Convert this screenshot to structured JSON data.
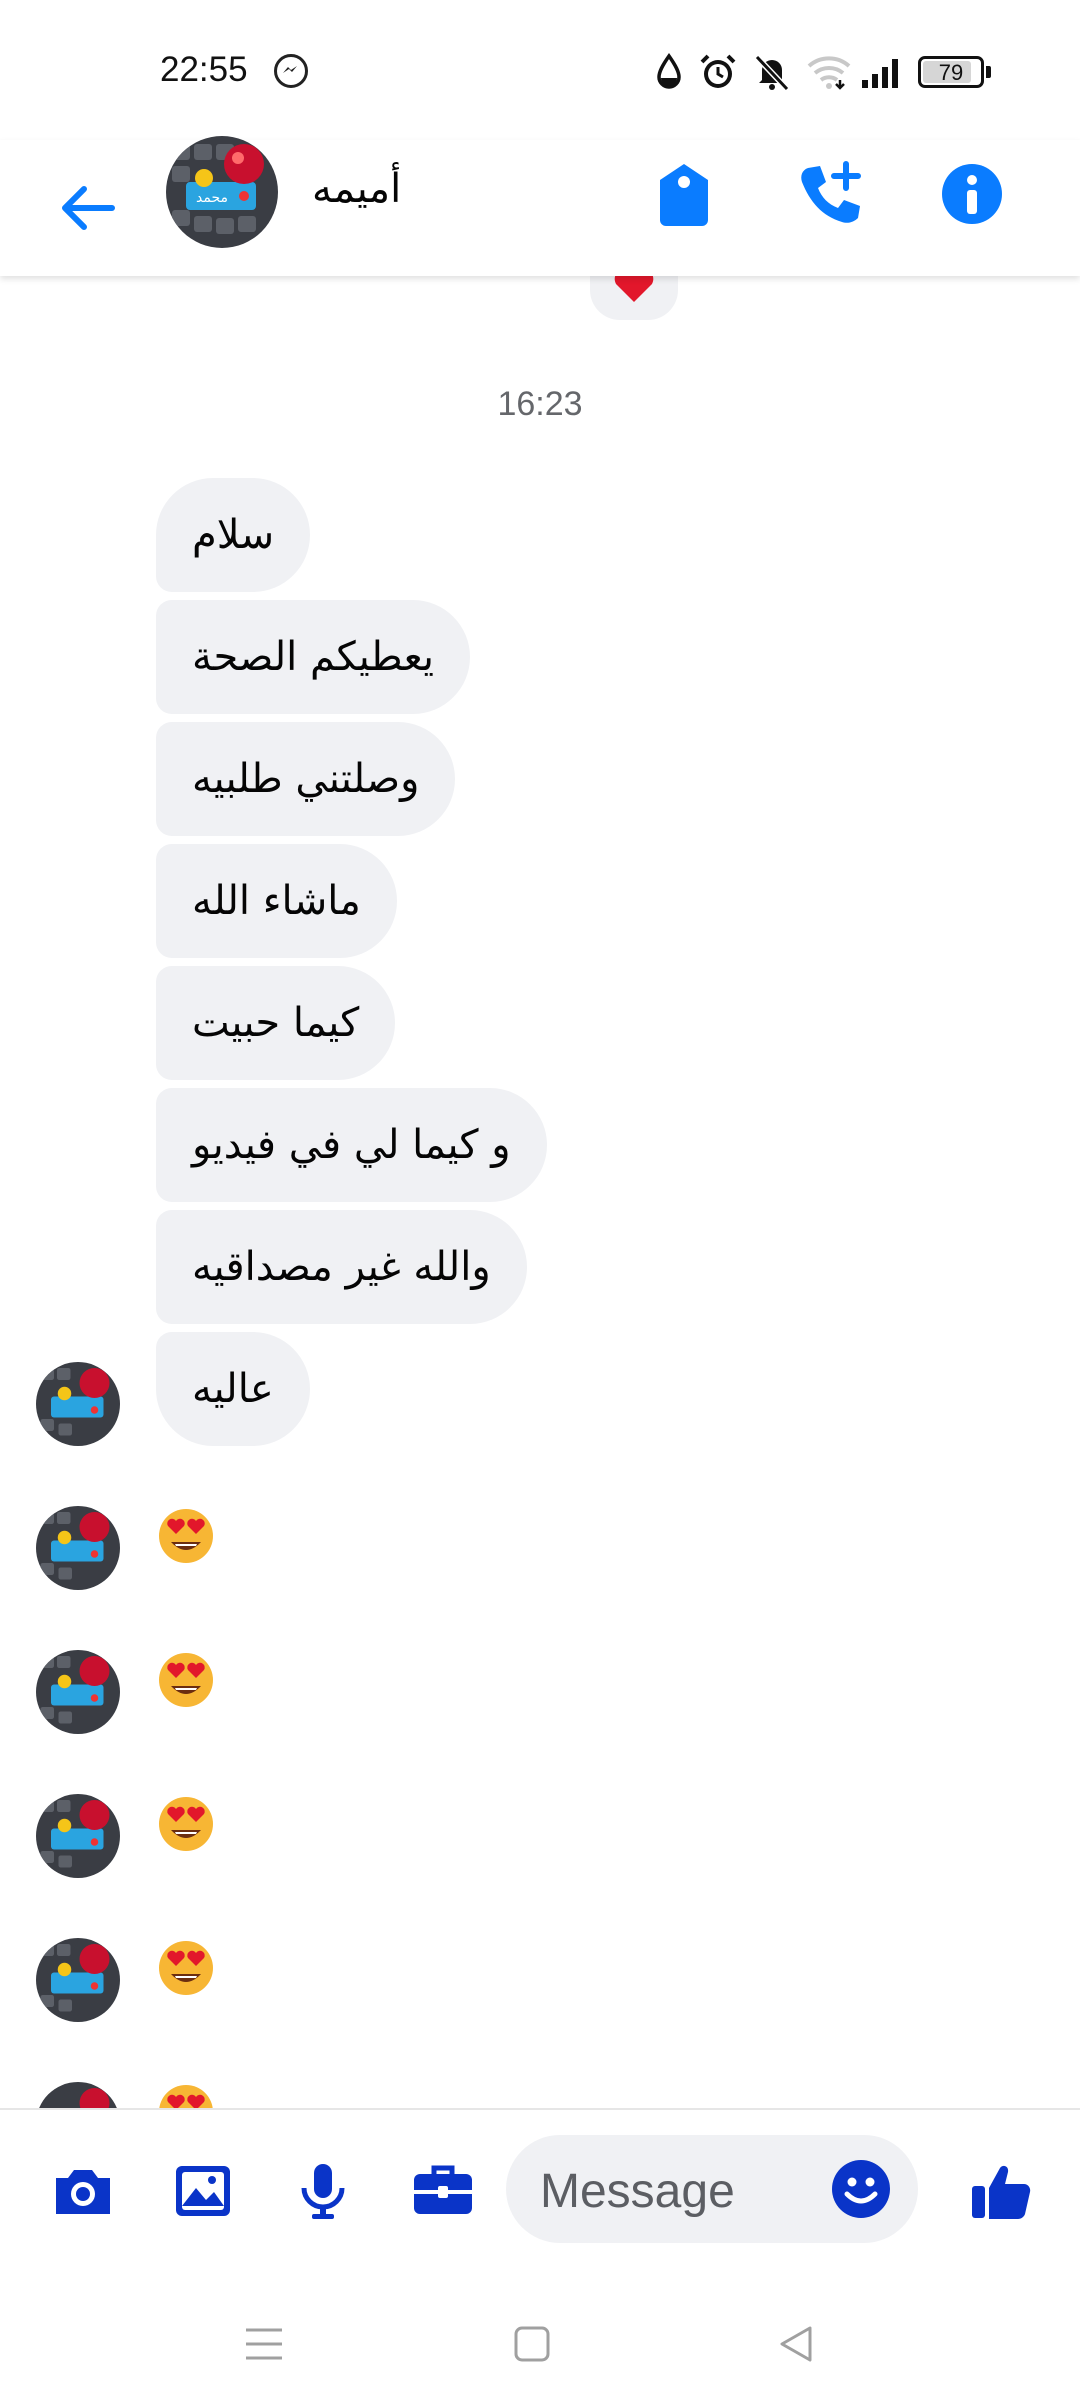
{
  "status_bar": {
    "time": "22:55",
    "battery": "79"
  },
  "header": {
    "contact_name": "أميمه"
  },
  "timestamp": "16:23",
  "messages": [
    {
      "text": "سلام"
    },
    {
      "text": "يعطيكم الصحة"
    },
    {
      "text": "وصلتني طلبيه"
    },
    {
      "text": "ماشاء الله"
    },
    {
      "text": "كيما حبيت"
    },
    {
      "text": "و كيما لي في فيديو"
    },
    {
      "text": "والله غير مصداقيه"
    },
    {
      "text": "عاليه"
    }
  ],
  "composer": {
    "placeholder": "Message"
  },
  "colors": {
    "accent": "#0a7cff",
    "brand_blue": "#0a34c8",
    "bubble": "#f0f1f4"
  },
  "icons": [
    "messenger-icon",
    "water-drop-icon",
    "alarm-icon",
    "bell-off-icon",
    "wifi-icon",
    "signal-icon",
    "battery-icon",
    "back-arrow-icon",
    "tag-icon",
    "add-call-icon",
    "info-icon",
    "camera-icon",
    "gallery-icon",
    "mic-icon",
    "briefcase-icon",
    "emoji-icon",
    "like-icon",
    "menu-icon",
    "home-icon",
    "back-triangle-icon"
  ]
}
